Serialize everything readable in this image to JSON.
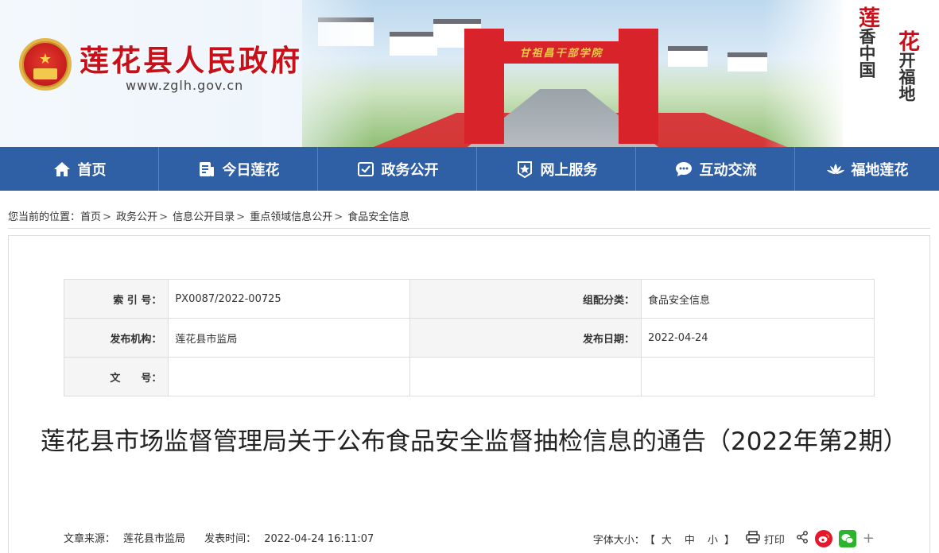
{
  "header": {
    "site_title": "莲花县人民政府",
    "site_url": "www.zglh.gov.cn",
    "arch_inscription": "甘祖昌干部学院",
    "slogan_left": [
      "莲",
      "香",
      "中",
      "国"
    ],
    "slogan_right": [
      "花",
      "开",
      "福",
      "地"
    ]
  },
  "nav": {
    "items": [
      {
        "label": "首页",
        "icon": "home-icon"
      },
      {
        "label": "今日莲花",
        "icon": "news-icon"
      },
      {
        "label": "政务公开",
        "icon": "open-gov-icon"
      },
      {
        "label": "网上服务",
        "icon": "service-star-icon"
      },
      {
        "label": "互动交流",
        "icon": "chat-bubble-icon"
      },
      {
        "label": "福地莲花",
        "icon": "lotus-icon"
      }
    ]
  },
  "breadcrumb": {
    "prefix": "您当前的位置：",
    "items": [
      "首页",
      "政务公开",
      "信息公开目录",
      "重点领域信息公开",
      "食品安全信息"
    ],
    "separator": ">"
  },
  "meta": {
    "index_label": "索 引 号：",
    "index_value": "PX0087/2022-00725",
    "category_label": "组配分类：",
    "category_value": "食品安全信息",
    "publisher_label": "发布机构：",
    "publisher_value": "莲花县市监局",
    "date_label": "发布日期：",
    "date_value": "2022-04-24",
    "docno_label": "文　　号：",
    "docno_value": ""
  },
  "article": {
    "title": "莲花县市场监督管理局关于公布食品安全监督抽检信息的通告（2022年第2期）",
    "source_label": "文章来源：",
    "source_value": "莲花县市监局",
    "time_label": "发表时间：",
    "time_value": "2022-04-24 16:11:07",
    "fontsize_label": "字体大小：",
    "fontsize_open": "【",
    "fontsize_large": "大",
    "fontsize_medium": "中",
    "fontsize_small": "小",
    "fontsize_close": "】",
    "print_label": "打印",
    "plus_label": "+"
  },
  "colors": {
    "nav_bg": "#2f5fa5",
    "title_red": "#c8101a",
    "arch_red": "#d8232a"
  }
}
